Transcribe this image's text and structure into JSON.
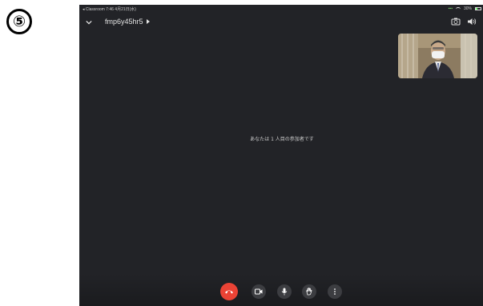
{
  "page": {
    "step_marker": "⑤"
  },
  "status_bar": {
    "left_text": "◂ Classroom  7:46  4月21日(水)",
    "battery_text": "30%"
  },
  "meeting": {
    "code": "fmp6y45hr5",
    "participant_message": "あなたは 1 人目の参加者です"
  },
  "controls": {
    "hangup": "hangup-icon",
    "camera": "camera-icon",
    "microphone": "microphone-icon",
    "raise_hand": "raise-hand-icon",
    "more": "more-options-icon"
  },
  "colors": {
    "background": "#222327",
    "hangup": "#ea4335",
    "control_button": "#3c3d41",
    "text": "#e5e5e5"
  }
}
